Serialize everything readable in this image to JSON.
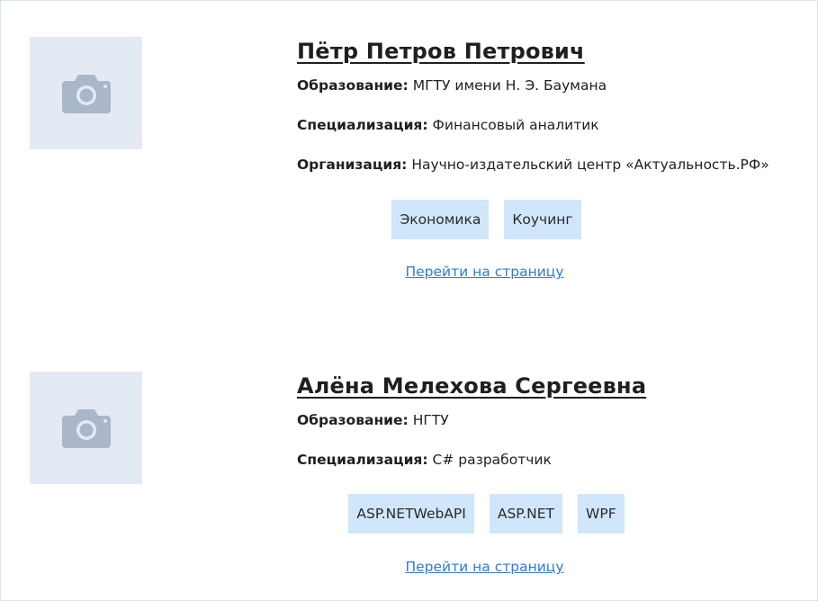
{
  "experts": [
    {
      "name": "Пётр Петров Петрович",
      "education_label": "Образование:",
      "education": "МГТУ имени Н. Э. Баумана",
      "specialization_label": "Специализация:",
      "specialization": "Финансовый аналитик",
      "organization_label": "Организация:",
      "organization": "Научно-издательский центр «Актуальность.РФ»",
      "tags": [
        "Экономика",
        "Коучинг"
      ],
      "link": "Перейти на страницу",
      "photo_icon": "camera-icon"
    },
    {
      "name": "Алёна Мелехова Сергеевна",
      "education_label": "Образование:",
      "education": "НГТУ",
      "specialization_label": "Специализация:",
      "specialization": "C# разработчик",
      "tags": [
        "ASP.NETWebAPI",
        "ASP.NET",
        "WPF"
      ],
      "link": "Перейти на страницу",
      "photo_icon": "camera-icon"
    }
  ],
  "colors": {
    "photo_bg": "#e3eaf3",
    "camera": "#a9b7c8",
    "tag_bg": "#cfe6fb",
    "link": "#2f7bd8"
  }
}
